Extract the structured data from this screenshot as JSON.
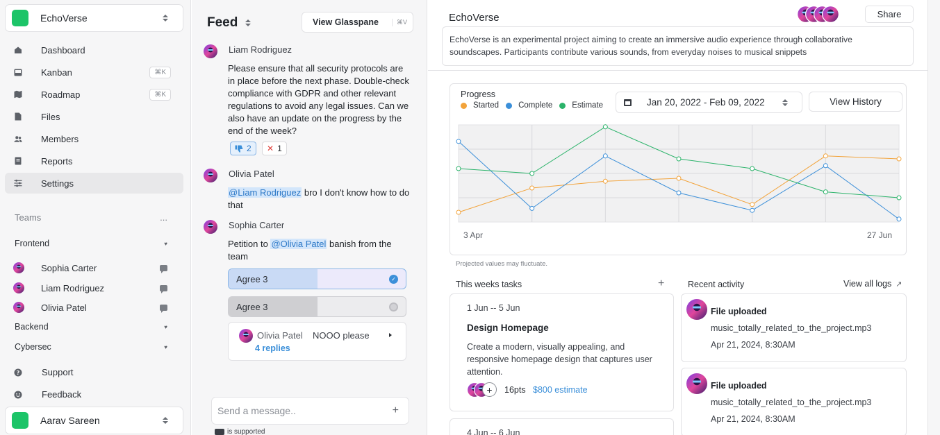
{
  "workspace": {
    "name": "EchoVerse",
    "logo_color": "#1cc468"
  },
  "sidebar": {
    "nav": [
      {
        "label": "Dashboard",
        "icon": "home-icon",
        "shortcut": ""
      },
      {
        "label": "Kanban",
        "icon": "inbox-icon",
        "shortcut": "⌘K"
      },
      {
        "label": "Roadmap",
        "icon": "map-icon",
        "shortcut": "⌘K"
      },
      {
        "label": "Files",
        "icon": "file-icon",
        "shortcut": ""
      },
      {
        "label": "Members",
        "icon": "users-icon",
        "shortcut": ""
      },
      {
        "label": "Reports",
        "icon": "report-icon",
        "shortcut": ""
      },
      {
        "label": "Settings",
        "icon": "sliders-icon",
        "shortcut": "",
        "active": true
      }
    ],
    "teams_label": "Teams",
    "teams_more": "...",
    "teams": [
      {
        "name": "Frontend",
        "members": [
          "Sophia Carter",
          "Liam Rodriguez",
          "Olivia Patel"
        ]
      },
      {
        "name": "Backend"
      },
      {
        "name": "Cybersec"
      }
    ],
    "footer_nav": [
      {
        "label": "Support",
        "icon": "help-icon"
      },
      {
        "label": "Feedback",
        "icon": "smiley-icon"
      }
    ],
    "user": {
      "name": "Aarav Sareen"
    }
  },
  "feed": {
    "title": "Feed",
    "glasspane_label": "View Glasspane",
    "glasspane_shortcut": "⌘V",
    "messages": [
      {
        "author": "Liam Rodriguez",
        "text": "Please ensure that all security protocols are in place before the next phase. Double-check compliance with GDPR and other relevant regulations to avoid any legal issues. Can we also have an update on the progress by the end of the week?",
        "reactions": [
          {
            "icon": "thumbs-down-icon",
            "count": "2"
          },
          {
            "icon": "x-icon",
            "count": "1"
          }
        ]
      },
      {
        "author": "Olivia Patel",
        "mention": "@Liam Rodriguez",
        "text": " bro I don't know how to do that"
      },
      {
        "author": "Sophia Carter",
        "prefix": "Petition to ",
        "mention": "@Olivia Patel",
        "suffix": " banish from the team",
        "poll": [
          {
            "label": "Agree 3",
            "fill": 0.5,
            "selected": true
          },
          {
            "label": "Agree 3",
            "fill": 0.5,
            "selected": false
          }
        ],
        "thread": {
          "author": "Olivia Patel",
          "text": "NOOO please",
          "replies": "4 replies"
        }
      }
    ],
    "composer_placeholder": "Send a message..",
    "markdown_note": "is supported"
  },
  "project": {
    "title": "EchoVerse",
    "share_label": "Share",
    "description": "EchoVerse is an experimental project aiming to create an immersive audio experience through collaborative soundscapes. Participants contribute various sounds, from everyday noises to musical snippets"
  },
  "progress": {
    "title": "Progress",
    "date_range": "Jan 20, 2022 - Feb 09, 2022",
    "history_label": "View History",
    "note": "Projected values may fluctuate."
  },
  "chart_data": {
    "type": "line",
    "x_start_label": "3 Apr",
    "x_end_label": "27 Jun",
    "grid": true,
    "legend_placement": "top-left",
    "series": [
      {
        "name": "Started",
        "color": "#f2a33a",
        "values": [
          0.1,
          0.35,
          0.42,
          0.45,
          0.18,
          0.68,
          0.65
        ]
      },
      {
        "name": "Complete",
        "color": "#3b8fd9",
        "values": [
          0.83,
          0.14,
          0.68,
          0.3,
          0.12,
          0.58,
          0.03
        ]
      },
      {
        "name": "Estimate",
        "color": "#2bb36a",
        "values": [
          0.55,
          0.5,
          0.98,
          0.65,
          0.55,
          0.31,
          0.25
        ]
      }
    ]
  },
  "tasks": {
    "header": "This weeks tasks",
    "add_icon": "plus-icon",
    "items": [
      {
        "dates": "1 Jun -- 5 Jun",
        "name": "Design Homepage",
        "description": "Create a modern, visually appealing, and responsive homepage design that captures user attention.",
        "points": "16pts",
        "estimate": "$800 estimate"
      },
      {
        "dates": "4 Jun -- 6 Jun"
      }
    ]
  },
  "activity": {
    "header": "Recent activity",
    "view_all": "View all logs",
    "items": [
      {
        "title": "File uploaded",
        "file": "music_totally_related_to_the_project.mp3",
        "date": "Apr 21, 2024, 8:30AM"
      },
      {
        "title": "File uploaded",
        "file": "music_totally_related_to_the_project.mp3",
        "date": "Apr 21, 2024, 8:30AM"
      }
    ]
  }
}
